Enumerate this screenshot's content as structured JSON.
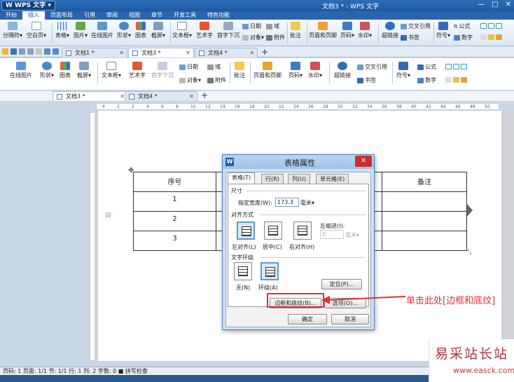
{
  "app": {
    "logo": "W WPS 文字 ▾",
    "window_title": "文档3 * - WPS 文字",
    "win_buttons": [
      "—",
      "□",
      "✕"
    ]
  },
  "menu": [
    "开始",
    "插入",
    "页面布局",
    "引用",
    "审阅",
    "视图",
    "章节",
    "开发工具",
    "特色功能"
  ],
  "ribbon": {
    "items": [
      "分隔符▾",
      "空白页▾",
      "表格▾",
      "图片▾",
      "在线图片",
      "形状▾",
      "图表",
      "截屏▾",
      "文本框▾",
      "艺术字",
      "首字下沉",
      "批注",
      "页眉和页脚",
      "页码▾",
      "水印▾",
      "超链接",
      "符号▾",
      "数字"
    ],
    "small": [
      "日期",
      "域",
      "对象▾",
      "附件",
      "交叉引用",
      "书签",
      "π 公式"
    ]
  },
  "doc_tabs_top": [
    "文档1 *",
    "文档3 *",
    "文档4 *"
  ],
  "ribbon2": {
    "items": [
      "在线图片",
      "形状▾",
      "图表",
      "截屏▾",
      "文本框▾",
      "艺术字",
      "首字下沉",
      "批注",
      "页眉和页脚",
      "页码▾",
      "水印▾",
      "超链接",
      "符号▾",
      "数字"
    ],
    "small": [
      "日期",
      "域",
      "对象▾",
      "附件",
      "交叉引用",
      "书签",
      "公式"
    ]
  },
  "doc_tabs_bottom": [
    "文档3 *",
    "文档4 *"
  ],
  "ruler_marks": [
    "4",
    "2",
    "2",
    "4",
    "6",
    "8",
    "10",
    "12",
    "14",
    "16",
    "18",
    "20",
    "22",
    "24",
    "26",
    "28",
    "30",
    "32",
    "34",
    "36",
    "38",
    "40",
    "42",
    "44",
    "46",
    "48",
    "50"
  ],
  "table": {
    "header": [
      "序号",
      "",
      "",
      "备注"
    ],
    "rows": [
      [
        "1",
        "",
        "",
        ""
      ],
      [
        "2",
        "",
        "",
        ""
      ],
      [
        "3",
        "",
        "",
        ""
      ]
    ]
  },
  "dialog": {
    "icon": "W",
    "title": "表格属性",
    "close": "✕",
    "tabs": [
      "表格(T)",
      "行(R)",
      "列(U)",
      "单元格(E)"
    ],
    "size_section": "尺寸",
    "width_label": "指定宽度(W):",
    "width_value": "173.3",
    "width_unit": "毫米▾",
    "align_section": "对齐方式",
    "align_options": [
      "左对齐(L)",
      "居中(C)",
      "右对齐(H)"
    ],
    "indent_label": "左缩进(I):",
    "indent_value": "0",
    "indent_unit": "毫米▾",
    "wrap_section": "文字环绕",
    "wrap_options": [
      "无(N)",
      "环绕(A)"
    ],
    "position_button": "定位(P)...",
    "border_button": "边框和底纹(B)...",
    "options_button": "选项(O)...",
    "ok_button": "确定",
    "cancel_button": "取消"
  },
  "annotation": "单击此处[边框和底纹]",
  "status": "页码: 1  页面: 1/1  节: 1/1  行: 1  列: 2  字数: 0  ■ 拼写检查",
  "watermark": {
    "line1": "易采站长站",
    "line2": "www.easck.com"
  },
  "colors": {
    "title_blue": "#1d5aa3",
    "annotation_red": "#e0313a",
    "dialog_close_red": "#c9302c"
  }
}
